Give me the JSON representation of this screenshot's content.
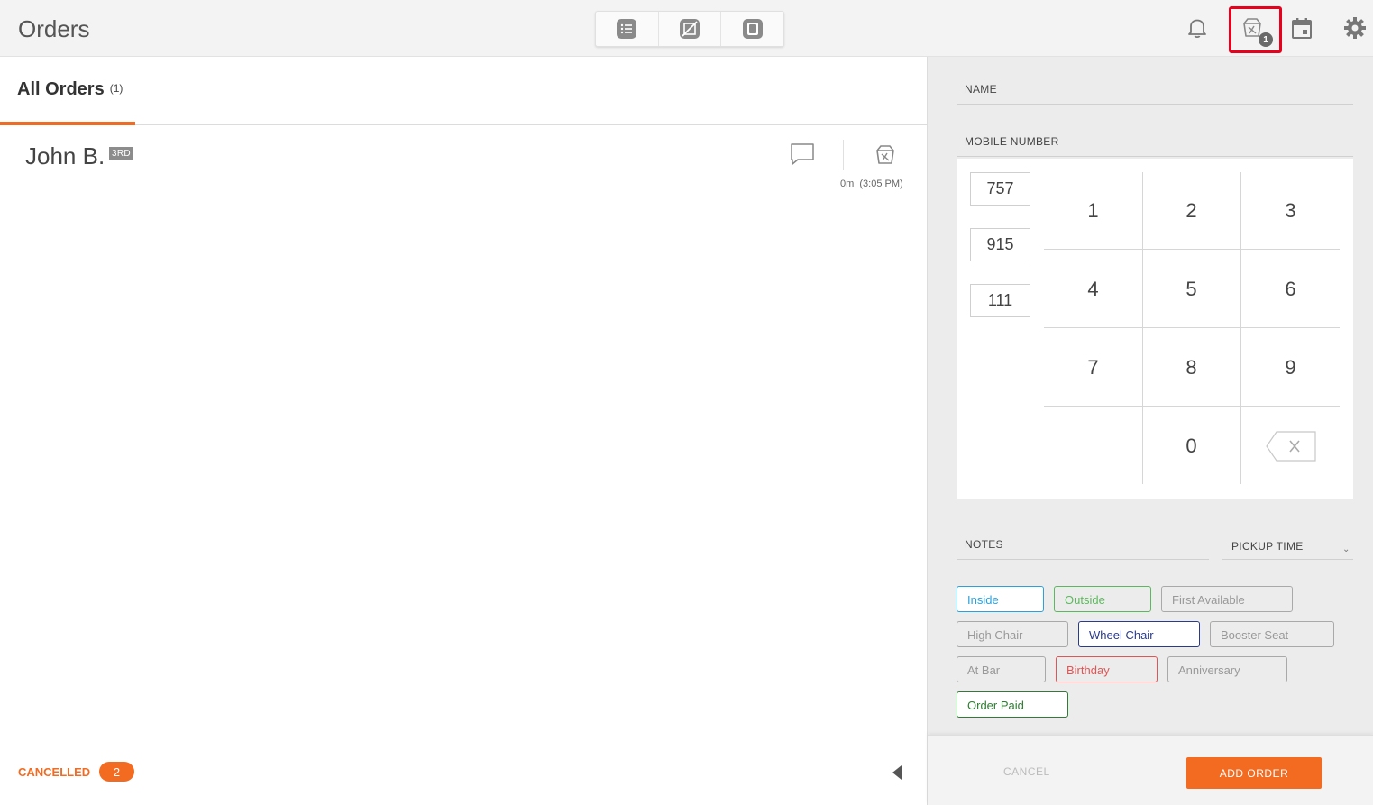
{
  "header": {
    "title": "Orders",
    "view_switch": [
      "list-view-icon",
      "no-wait-view-icon",
      "tablet-view-icon"
    ],
    "icons": [
      "bell-icon",
      "pickup-bag-icon",
      "calendar-icon",
      "gear-icon"
    ],
    "pickup_badge": "1"
  },
  "left": {
    "tab_label": "All Orders",
    "tab_count": "(1)",
    "orders": [
      {
        "name": "John B.",
        "tag": "3RD",
        "time": "0m  (3:05 PM)"
      }
    ],
    "footer": {
      "cancelled_label": "CANCELLED",
      "cancelled_count": "2"
    }
  },
  "form": {
    "name_label": "NAME",
    "mobile_label": "MOBILE NUMBER",
    "mobile_parts": [
      "757",
      "915",
      "111"
    ],
    "keys": [
      "1",
      "2",
      "3",
      "4",
      "5",
      "6",
      "7",
      "8",
      "9",
      "0"
    ],
    "notes_label": "NOTES",
    "pickup_label": "PICKUP TIME",
    "chips": [
      {
        "label": "Inside",
        "color": "#2aa0dc"
      },
      {
        "label": "Outside",
        "color": "#5cb85c"
      },
      {
        "label": "First Available",
        "color": "#999999"
      },
      {
        "label": "High Chair",
        "color": "#999999"
      },
      {
        "label": "Wheel Chair",
        "color": "#2a3a8c"
      },
      {
        "label": "Booster Seat",
        "color": "#999999"
      },
      {
        "label": "At Bar",
        "color": "#999999"
      },
      {
        "label": "Birthday",
        "color": "#e05555"
      },
      {
        "label": "Anniversary",
        "color": "#999999"
      },
      {
        "label": "Order Paid",
        "color": "#2e7d32"
      }
    ],
    "cancel_label": "CANCEL",
    "add_label": "ADD ORDER"
  },
  "colors": {
    "accent": "#f26b21",
    "highlight": "#e8001c"
  }
}
